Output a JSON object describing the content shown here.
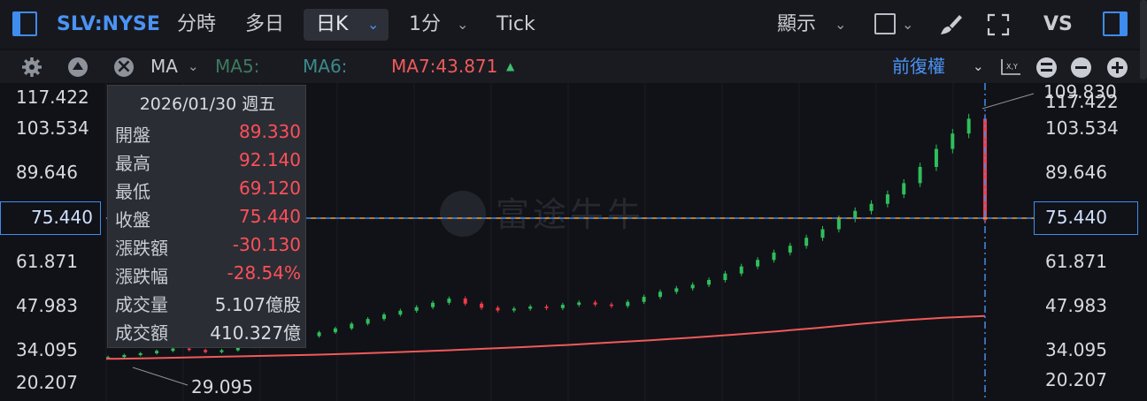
{
  "toolbar": {
    "symbol": "SLV:NYSE",
    "timeframes": [
      "分時",
      "多日",
      "日K",
      "1分",
      "Tick"
    ],
    "active_timeframe": "日K",
    "display_label": "顯示",
    "vs_label": "VS",
    "icons": [
      "panel-left-icon",
      "chevron-down-icon",
      "square-icon",
      "brush-icon",
      "expand-icon",
      "panel-right-icon"
    ]
  },
  "indicators": {
    "ma_label": "MA",
    "ma5": "MA5:",
    "ma6": "MA6:",
    "ma7": "MA7:43.871",
    "adjust_label": "前復權",
    "colors": {
      "ma5": "#3e7a5f",
      "ma6": "#3c8a8c",
      "ma7": "#f05a5a"
    }
  },
  "axis": {
    "y_left": [
      "117.422",
      "103.534",
      "89.646",
      "75.440",
      "61.871",
      "47.983",
      "34.095",
      "20.207"
    ],
    "y_right": [
      "117.422",
      "103.534",
      "89.646",
      "75.440",
      "61.871",
      "47.983",
      "34.095",
      "20.207"
    ],
    "crosshair_price": "75.440",
    "high_callout": "109.830",
    "low_callout": "29.095"
  },
  "tooltip": {
    "date": "2026/01/30 週五",
    "rows": [
      {
        "label": "開盤",
        "value": "89.330"
      },
      {
        "label": "最高",
        "value": "92.140"
      },
      {
        "label": "最低",
        "value": "69.120"
      },
      {
        "label": "收盤",
        "value": "75.440"
      },
      {
        "label": "漲跌額",
        "value": "-30.130"
      },
      {
        "label": "漲跌幅",
        "value": "-28.54%"
      },
      {
        "label": "成交量",
        "value": "5.107億股"
      },
      {
        "label": "成交額",
        "value": "410.327億"
      }
    ]
  },
  "watermark": "富途牛牛",
  "colors": {
    "up": "#2fbf5b",
    "down": "#f23b4a",
    "accent": "#3f8cf0",
    "crosshair": "#ff9f1a"
  },
  "chart_data": {
    "type": "candlestick",
    "ylim": [
      20.207,
      117.422
    ],
    "ma7_line": [
      28.5,
      28.7,
      29.0,
      29.3,
      29.6,
      29.9,
      30.3,
      30.8,
      31.3,
      31.9,
      32.5,
      33.2,
      34.0,
      34.8,
      35.7,
      36.7,
      37.8,
      39.0,
      40.3,
      41.5,
      42.4,
      43.0
    ],
    "closes": [
      29.1,
      29.8,
      30.4,
      31.2,
      32.0,
      31.5,
      30.8,
      31.4,
      32.6,
      33.5,
      34.2,
      35.0,
      36.2,
      37.5,
      38.8,
      40.4,
      42.0,
      43.5,
      44.8,
      46.0,
      47.5,
      48.9,
      47.2,
      45.8,
      44.9,
      45.5,
      46.2,
      45.7,
      46.8,
      47.6,
      46.9,
      46.4,
      47.8,
      49.5,
      51.2,
      52.4,
      53.6,
      55.2,
      57.4,
      59.8,
      62.0,
      64.5,
      66.8,
      69.5,
      72.4,
      75.9,
      78.6,
      81.0,
      84.2,
      88.0,
      93.5,
      99.6,
      104.8,
      109.83,
      75.44
    ]
  }
}
